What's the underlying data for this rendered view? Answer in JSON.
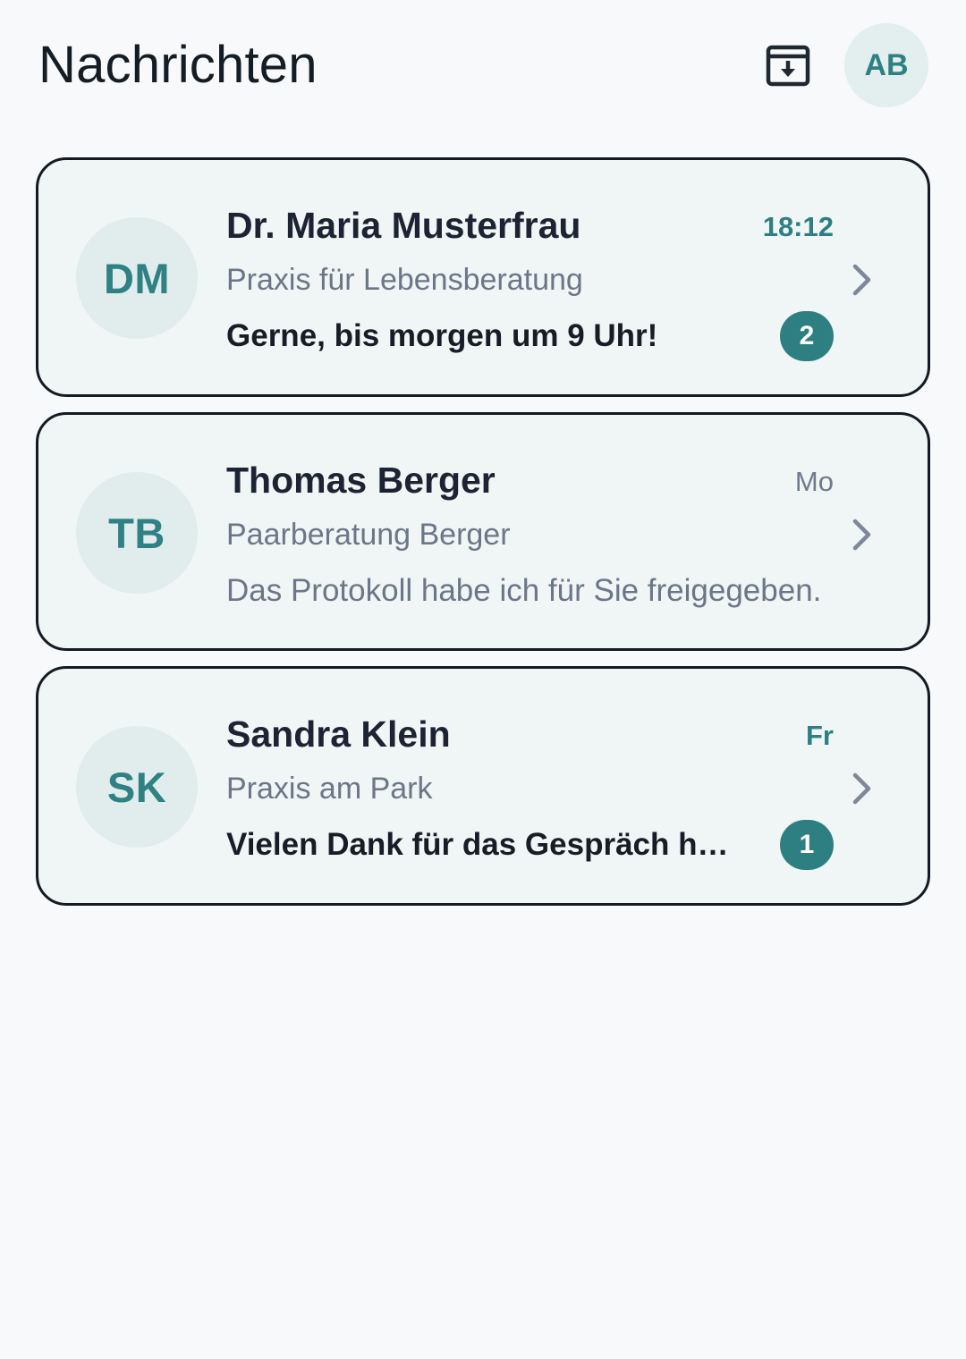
{
  "header": {
    "title": "Nachrichten",
    "archive_icon": "archive-download-icon",
    "user_initials": "AB"
  },
  "colors": {
    "accent": "#2e7f82",
    "avatar_bg": "#e1ecec",
    "card_bg": "#f0f5f5",
    "card_border": "#131a22",
    "page_bg": "#f7f9fb",
    "muted_text": "#6b7788"
  },
  "conversations": [
    {
      "initials": "DM",
      "name": "Dr. Maria Musterfrau",
      "practice": "Praxis für Lebensberatung",
      "time": "18:12",
      "preview": "Gerne, bis morgen um 9 Uhr!",
      "unread_count": "2",
      "unread": true
    },
    {
      "initials": "TB",
      "name": "Thomas Berger",
      "practice": "Paarberatung Berger",
      "time": "Mo",
      "preview": "Das Protokoll habe ich für Sie freigegeben.",
      "unread_count": "",
      "unread": false
    },
    {
      "initials": "SK",
      "name": "Sandra Klein",
      "practice": "Praxis am Park",
      "time": "Fr",
      "preview": "Vielen Dank für das Gespräch heute.",
      "unread_count": "1",
      "unread": true
    }
  ]
}
